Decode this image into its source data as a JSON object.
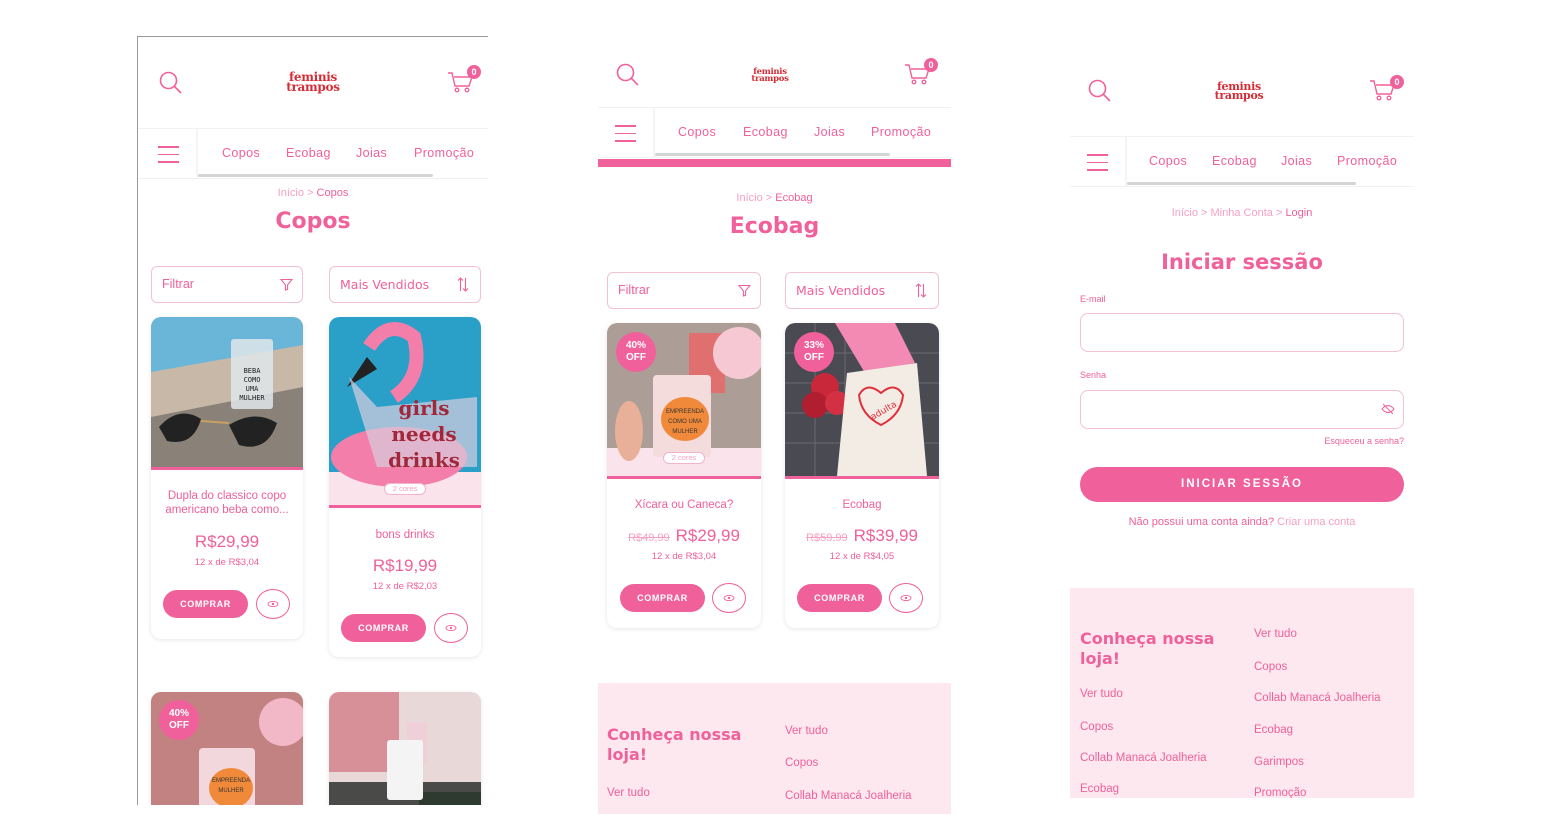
{
  "brand": {
    "logo_line1": "feminis",
    "logo_line2": "trampos",
    "cart_count": "0"
  },
  "nav": {
    "items": [
      "Copos",
      "Ecobag",
      "Joias",
      "Promoção"
    ]
  },
  "colors": {
    "accent": "#f0609a",
    "logo": "#d62c36",
    "footer_bg": "#fde8ef"
  },
  "controls": {
    "filter_label": "Filtrar",
    "sort_label": "Mais Vendidos",
    "buy_label": "COMPRAR",
    "colors_chip": "2 cores"
  },
  "screen1": {
    "breadcrumb": {
      "home": "Início",
      "sep": ">",
      "current": "Copos"
    },
    "title": "Copos",
    "products": [
      {
        "name": "Dupla do classico copo americano beba como...",
        "price": "R$29,99",
        "installments_prefix": "12 x de",
        "installments_value": "R$3,04"
      },
      {
        "name": "bons drinks",
        "price": "R$19,99",
        "installments_prefix": "12 x de",
        "installments_value": "R$2,03"
      }
    ],
    "more_badge": "40% OFF"
  },
  "screen2": {
    "breadcrumb": {
      "home": "Início",
      "sep": ">",
      "current": "Ecobag"
    },
    "title": "Ecobag",
    "products": [
      {
        "badge_pct": "40%",
        "badge_off": "OFF",
        "name": "Xícara ou Caneca?",
        "old_price": "R$49,99",
        "price": "R$29,99",
        "installments_prefix": "12 x de",
        "installments_value": "R$3,04"
      },
      {
        "badge_pct": "33%",
        "badge_off": "OFF",
        "name": "Ecobag",
        "old_price": "R$59,99",
        "price": "R$39,99",
        "installments_prefix": "12 x de",
        "installments_value": "R$4,05"
      }
    ],
    "footer": {
      "title": "Conheça nossa loja!",
      "col1": [
        "Ver tudo"
      ],
      "col2": [
        "Ver tudo",
        "Copos",
        "Collab Manacá Joalheria"
      ]
    }
  },
  "screen3": {
    "breadcrumb": {
      "home": "Início",
      "sep": ">",
      "middle": "Minha Conta",
      "current": "Login"
    },
    "title": "Iniciar sessão",
    "email_label": "E-mail",
    "password_label": "Senha",
    "forgot": "Esqueceu a senha?",
    "submit": "INICIAR SESSÃO",
    "no_account": "Não possui uma conta ainda?",
    "create_account": "Criar uma conta",
    "footer": {
      "title": "Conheça nossa loja!",
      "col1": [
        "Ver tudo",
        "Copos",
        "Collab Manacá Joalheria",
        "Ecobag"
      ],
      "col2": [
        "Ver tudo",
        "Copos",
        "Collab Manacá Joalheria",
        "Ecobag",
        "Garimpos",
        "Promoção"
      ]
    }
  }
}
